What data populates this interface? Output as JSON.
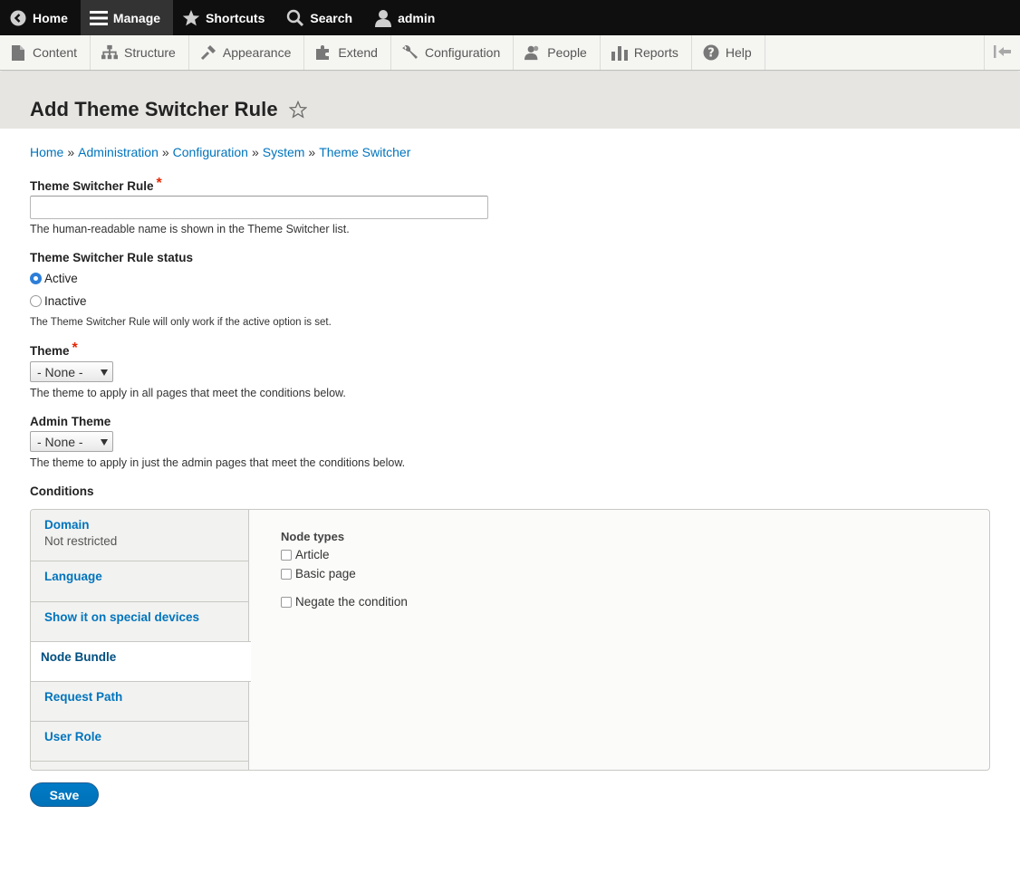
{
  "toolbar": {
    "home": "Home",
    "manage": "Manage",
    "shortcuts": "Shortcuts",
    "search": "Search",
    "user": "admin"
  },
  "tray": {
    "items": [
      "Content",
      "Structure",
      "Appearance",
      "Extend",
      "Configuration",
      "People",
      "Reports",
      "Help"
    ]
  },
  "page": {
    "title": "Add Theme Switcher Rule"
  },
  "breadcrumb": [
    "Home",
    "Administration",
    "Configuration",
    "System",
    "Theme Switcher"
  ],
  "breadcrumb_separator": "»",
  "form": {
    "rule_label": "Theme Switcher Rule",
    "required_mark": "*",
    "rule_value": "",
    "rule_description": "The human-readable name is shown in the Theme Switcher list.",
    "status_label": "Theme Switcher Rule status",
    "status_options": [
      "Active",
      "Inactive"
    ],
    "status_selected": "Active",
    "status_description": "The Theme Switcher Rule will only work if the active option is set.",
    "theme_label": "Theme",
    "theme_selected": "- None -",
    "theme_description": "The theme to apply in all pages that meet the conditions below.",
    "admin_theme_label": "Admin Theme",
    "admin_theme_selected": "- None -",
    "admin_theme_description": "The theme to apply in just the admin pages that meet the conditions below.",
    "conditions_label": "Conditions",
    "save_label": "Save"
  },
  "conditions": {
    "tabs": [
      {
        "title": "Domain",
        "summary": "Not restricted"
      },
      {
        "title": "Language",
        "summary": ""
      },
      {
        "title": "Show it on special devices",
        "summary": ""
      },
      {
        "title": "Node Bundle",
        "summary": ""
      },
      {
        "title": "Request Path",
        "summary": ""
      },
      {
        "title": "User Role",
        "summary": ""
      }
    ],
    "selected_tab": "Node Bundle",
    "pane": {
      "title": "Node types",
      "options": [
        "Article",
        "Basic page"
      ],
      "negate_label": "Negate the condition"
    }
  },
  "colors": {
    "link": "#0074bd",
    "toolbar_bg": "#0f0f0f",
    "primary_button": "#0071b8",
    "required": "#e32700"
  }
}
